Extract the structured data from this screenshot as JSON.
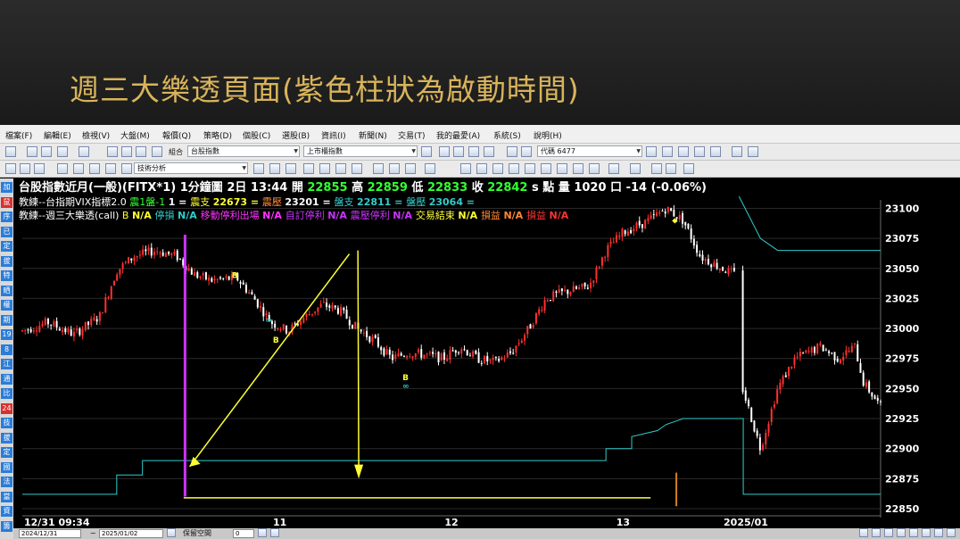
{
  "slide": {
    "title": "週三大樂透頁面(紫色柱狀為啟動時間)"
  },
  "menu": [
    "檔案(F)",
    "編輯(E)",
    "檢視(V)",
    "大盤(M)",
    "報價(Q)",
    "策略(D)",
    "個股(C)",
    "選股(B)",
    "資訊(I)",
    "新聞(N)",
    "交易(T)",
    "我的最愛(A)",
    "系統(S)",
    "說明(H)"
  ],
  "toolbar": {
    "group_label": "組合",
    "group_value": "台股指數",
    "market_value": "上市櫃指數",
    "code_label": "代碼",
    "code_value": "6477",
    "tech_label": "技術分析"
  },
  "sidetabs": [
    "加",
    "鼠",
    "序",
    "已",
    "定",
    "拔",
    "特",
    "晒",
    "權",
    "期",
    "19",
    "8",
    "江",
    "通",
    "比",
    "24",
    "技",
    "拔",
    "定",
    "國",
    "法",
    "當",
    "資",
    "籌"
  ],
  "quote": {
    "name": "台股指數近月(一般)(FITX*1)",
    "period": "1分鐘圖",
    "date_time": "2日 13:44",
    "open_label": "開",
    "open": "22855",
    "high_label": "高",
    "high": "22859",
    "low_label": "低",
    "low": "22833",
    "close_label": "收",
    "close": "22842",
    "unit": "s 點",
    "volume_label": "量",
    "volume": "1020 口",
    "change": "-14 (-0.06%)"
  },
  "indicator1": {
    "name": "教練--台指期VIX指標2.0",
    "items": [
      {
        "label": "震1盤-1",
        "value": "1 ="
      },
      {
        "label": "震支",
        "value": "22673 ="
      },
      {
        "label": "震壓",
        "value": "23201 ="
      },
      {
        "label": "盤支",
        "value": "22811 ="
      },
      {
        "label": "盤壓",
        "value": "23064 ="
      }
    ]
  },
  "indicator2": {
    "name": "教練--週三大樂透(call)",
    "items": [
      {
        "label": "B",
        "value": "N/A"
      },
      {
        "label": "停損",
        "value": "N/A"
      },
      {
        "label": "移動停利出場",
        "value": "N/A"
      },
      {
        "label": "自訂停利",
        "value": "N/A"
      },
      {
        "label": "震壓停利",
        "value": "N/A"
      },
      {
        "label": "交易結束",
        "value": "N/A"
      },
      {
        "label": "損益",
        "value": "N/A"
      },
      {
        "label": "損益",
        "value": "N/A"
      }
    ]
  },
  "markers": {
    "buy": "B",
    "exit": "∞"
  },
  "chart_data": {
    "type": "candlestick",
    "y_ticks": [
      "23100",
      "23075",
      "23050",
      "23025",
      "23000",
      "22975",
      "22950",
      "22925",
      "22900",
      "22875",
      "22850"
    ],
    "ylim": [
      22850,
      23110
    ],
    "x_labels": [
      "12/31 09:34",
      "11",
      "12",
      "13",
      "2025/01"
    ],
    "close_path": [
      [
        0,
        22998
      ],
      [
        0.03,
        23005
      ],
      [
        0.06,
        22995
      ],
      [
        0.09,
        23010
      ],
      [
        0.11,
        23048
      ],
      [
        0.13,
        23060
      ],
      [
        0.155,
        23065
      ],
      [
        0.18,
        23060
      ],
      [
        0.2,
        23045
      ],
      [
        0.22,
        23040
      ],
      [
        0.25,
        23042
      ],
      [
        0.27,
        23025
      ],
      [
        0.29,
        23005
      ],
      [
        0.31,
        22998
      ],
      [
        0.33,
        23010
      ],
      [
        0.35,
        23020
      ],
      [
        0.37,
        23015
      ],
      [
        0.39,
        23000
      ],
      [
        0.41,
        22990
      ],
      [
        0.43,
        22975
      ],
      [
        0.45,
        22980
      ],
      [
        0.47,
        22978
      ],
      [
        0.49,
        22975
      ],
      [
        0.51,
        22985
      ],
      [
        0.53,
        22975
      ],
      [
        0.55,
        22972
      ],
      [
        0.57,
        22980
      ],
      [
        0.59,
        23000
      ],
      [
        0.61,
        23025
      ],
      [
        0.63,
        23030
      ],
      [
        0.66,
        23035
      ],
      [
        0.68,
        23065
      ],
      [
        0.7,
        23080
      ],
      [
        0.73,
        23090
      ],
      [
        0.75,
        23100
      ],
      [
        0.77,
        23090
      ],
      [
        0.79,
        23060
      ],
      [
        0.81,
        23052
      ],
      [
        0.83,
        23045
      ],
      [
        0.835,
        22960
      ],
      [
        0.86,
        22900
      ],
      [
        0.88,
        22950
      ],
      [
        0.9,
        22975
      ],
      [
        0.93,
        22985
      ],
      [
        0.95,
        22975
      ],
      [
        0.97,
        22985
      ],
      [
        0.98,
        22955
      ],
      [
        1.0,
        22935
      ]
    ]
  },
  "status": {
    "date_from": "2024/12/31",
    "date_to": "2025/01/02",
    "gap_label": "保留空間",
    "gap_value": "0"
  },
  "colors": {
    "up": "#ff3030",
    "down": "#ffffff",
    "purple": "#cc33ff",
    "support": "#33cccc",
    "arrow": "#ffff33",
    "volume": "#d08020"
  }
}
